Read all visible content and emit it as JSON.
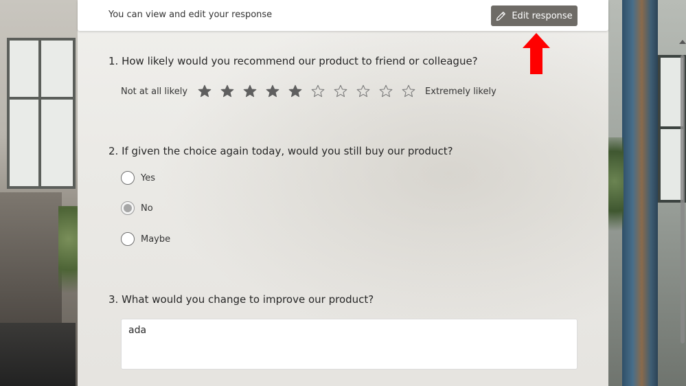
{
  "header": {
    "info_text": "You can view and edit your response",
    "edit_button_label": "Edit response"
  },
  "questions": [
    {
      "title": "1. How likely would you recommend our product to friend or colleague?",
      "type": "rating",
      "low_label": "Not at all likely",
      "high_label": "Extremely likely",
      "max": 10,
      "value": 5
    },
    {
      "title": "2. If given the choice again today, would you still buy our product?",
      "type": "choice",
      "options": [
        "Yes",
        "No",
        "Maybe"
      ],
      "selected": "No"
    },
    {
      "title": "3. What would you change to improve our product?",
      "type": "text",
      "value": "ada"
    }
  ],
  "colors": {
    "edit_button": "#6e6b66",
    "annotation_arrow": "#ff0000",
    "star_filled": "#5f5f5f"
  },
  "icons": {
    "edit": "pencil-icon",
    "rating": "star-icon",
    "annotation": "red-arrow-up"
  }
}
